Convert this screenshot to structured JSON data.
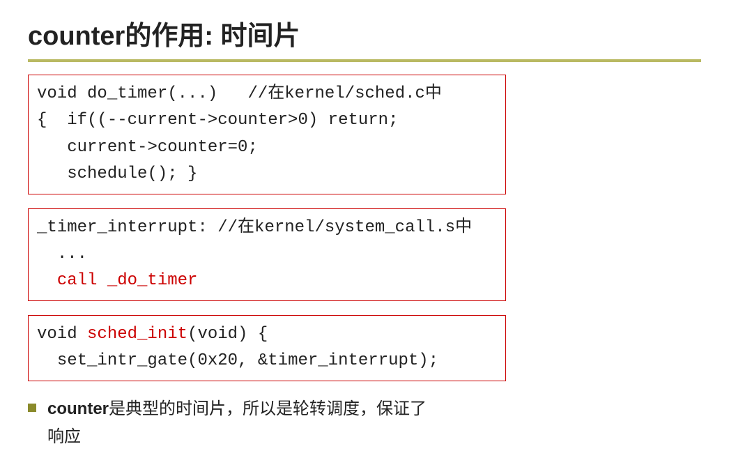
{
  "colors": {
    "accent_rule": "#b9b962",
    "box_border": "#cc0000",
    "bullet_square": "#8a8a2b",
    "code_red": "#cc0000"
  },
  "title": "counter的作用: 时间片",
  "code1": {
    "l1a": "void do_timer(...)   //",
    "l1b": "在",
    "l1c": "kernel/sched.c",
    "l1d": "中",
    "l2": "{  if((--current->counter>0) return;",
    "l3": "   current->counter=0;",
    "l4": "   schedule(); }"
  },
  "code2": {
    "l1a": "_timer_interrupt: //",
    "l1b": "在",
    "l1c": "kernel/system_call.s",
    "l1d": "中",
    "l2": "  ...",
    "l3a": "  ",
    "l3b": "call _do_timer"
  },
  "code3": {
    "l1a": "void ",
    "l1b": "sched_init",
    "l1c": "(void) {",
    "l2": "  set_intr_gate(0x20, &timer_interrupt);"
  },
  "bullet": {
    "b1_bold": "counter",
    "b1_rest": "是典型的时间片，所以是轮转调度，保证了",
    "b1_line2": "响应"
  }
}
